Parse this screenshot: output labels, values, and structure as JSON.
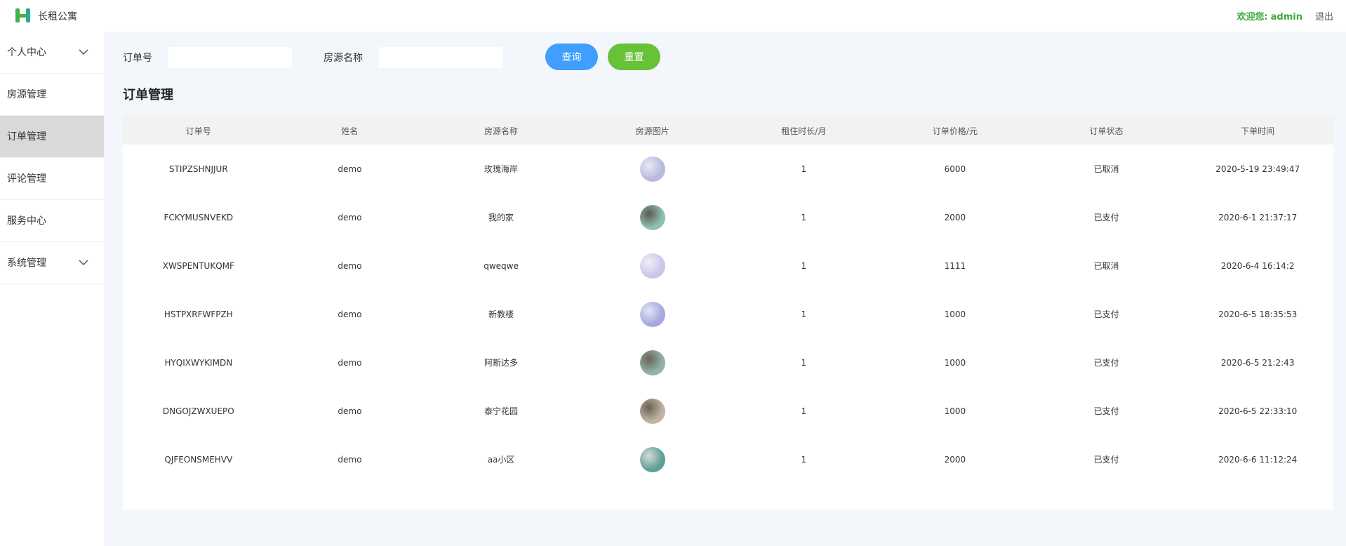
{
  "header": {
    "app_title": "长租公寓",
    "welcome_label": "欢迎您:",
    "username": "admin",
    "logout_label": "退出",
    "accent_color": "#3fa83f"
  },
  "sidebar": {
    "items": [
      {
        "label": "个人中心",
        "has_submenu": true,
        "active": false
      },
      {
        "label": "房源管理",
        "has_submenu": false,
        "active": false
      },
      {
        "label": "订单管理",
        "has_submenu": false,
        "active": true
      },
      {
        "label": "评论管理",
        "has_submenu": false,
        "active": false
      },
      {
        "label": "服务中心",
        "has_submenu": false,
        "active": false
      },
      {
        "label": "系统管理",
        "has_submenu": true,
        "active": false
      }
    ]
  },
  "search": {
    "order_no_label": "订单号",
    "order_no_value": "",
    "house_name_label": "房源名称",
    "house_name_value": "",
    "query_label": "查询",
    "reset_label": "重置"
  },
  "page_title": "订单管理",
  "table": {
    "columns": [
      "订单号",
      "姓名",
      "房源名称",
      "房源图片",
      "租住时长/月",
      "订单价格/元",
      "订单状态",
      "下单时间"
    ],
    "rows": [
      {
        "order_no": "STIPZSHNJJUR",
        "name": "demo",
        "house": "玫瑰海岸",
        "image": "room-thumbnail",
        "months": "1",
        "price": "6000",
        "status": "已取消",
        "time": "2020-5-19 23:49:47"
      },
      {
        "order_no": "FCKYMUSNVEKD",
        "name": "demo",
        "house": "我的家",
        "image": "room-thumbnail",
        "months": "1",
        "price": "2000",
        "status": "已支付",
        "time": "2020-6-1 21:37:17"
      },
      {
        "order_no": "XWSPENTUKQMF",
        "name": "demo",
        "house": "qweqwe",
        "image": "room-thumbnail",
        "months": "1",
        "price": "1111",
        "status": "已取消",
        "time": "2020-6-4 16:14:2"
      },
      {
        "order_no": "HSTPXRFWFPZH",
        "name": "demo",
        "house": "新教楼",
        "image": "room-thumbnail",
        "months": "1",
        "price": "1000",
        "status": "已支付",
        "time": "2020-6-5 18:35:53"
      },
      {
        "order_no": "HYQIXWYKIMDN",
        "name": "demo",
        "house": "阿斯达多",
        "image": "room-thumbnail",
        "months": "1",
        "price": "1000",
        "status": "已支付",
        "time": "2020-6-5 21:2:43"
      },
      {
        "order_no": "DNGOJZWXUEPO",
        "name": "demo",
        "house": "泰宁花园",
        "image": "room-thumbnail",
        "months": "1",
        "price": "1000",
        "status": "已支付",
        "time": "2020-6-5 22:33:10"
      },
      {
        "order_no": "QJFEONSMEHVV",
        "name": "demo",
        "house": "aa小区",
        "image": "room-thumbnail",
        "months": "1",
        "price": "2000",
        "status": "已支付",
        "time": "2020-6-6 11:12:24"
      }
    ]
  }
}
